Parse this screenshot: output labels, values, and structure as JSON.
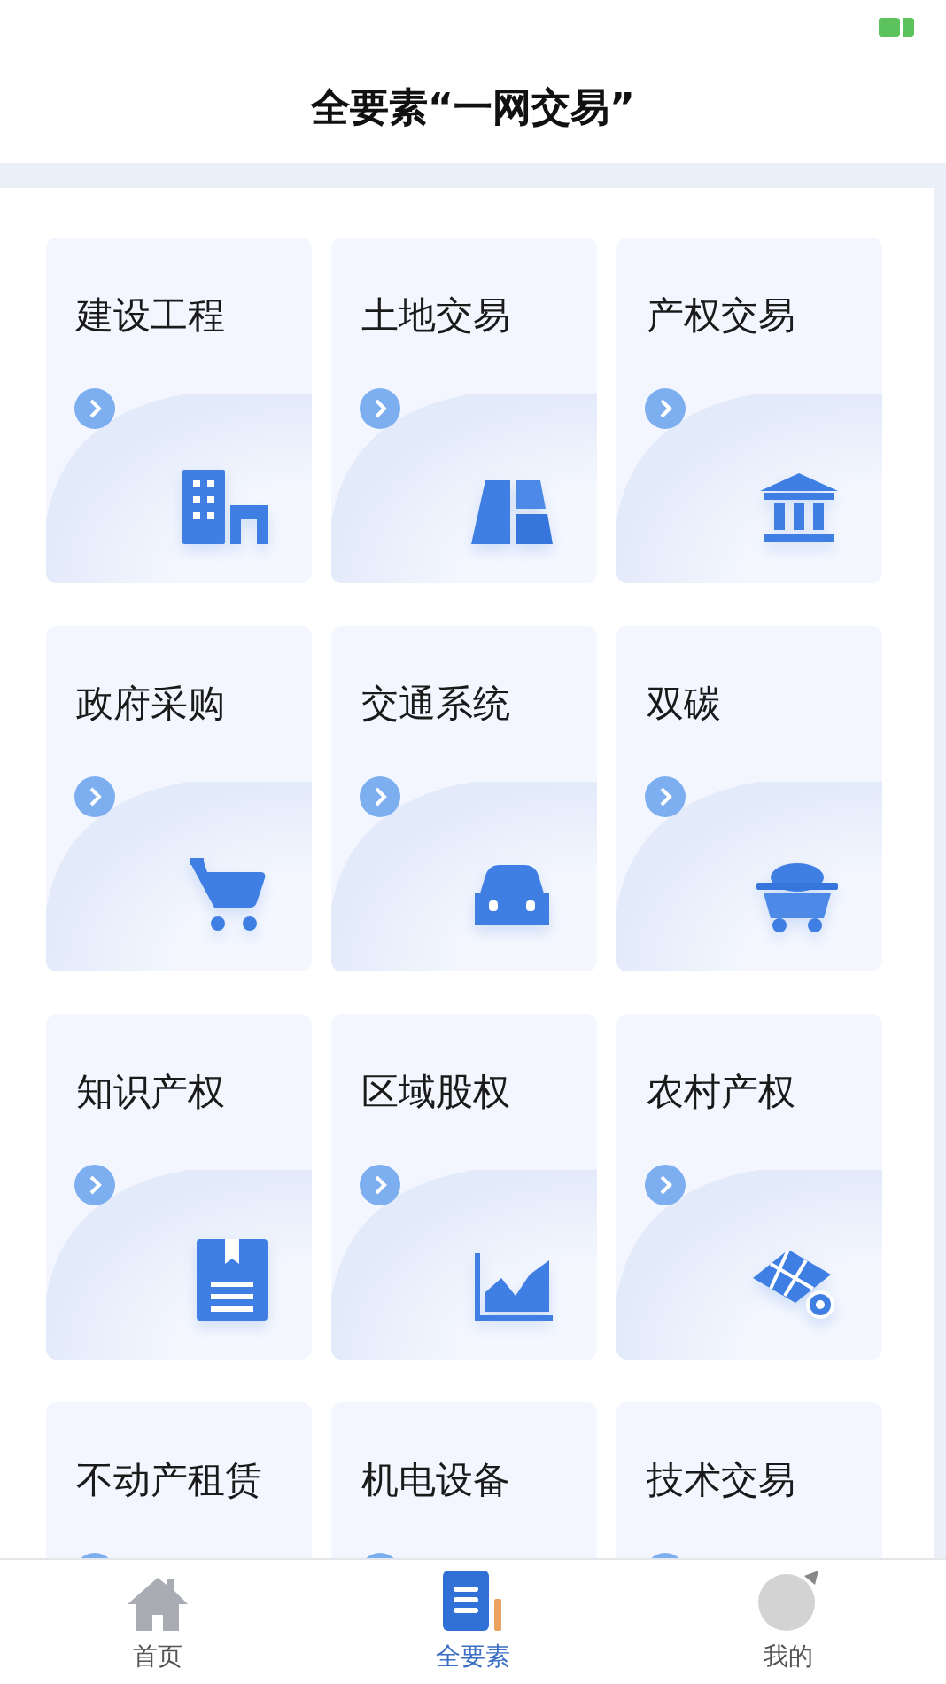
{
  "header": {
    "title": "全要素“一网交易”"
  },
  "cards": [
    {
      "title": "建设工程"
    },
    {
      "title": "土地交易"
    },
    {
      "title": "产权交易"
    },
    {
      "title": "政府采购"
    },
    {
      "title": "交通系统"
    },
    {
      "title": "双碳"
    },
    {
      "title": "知识产权"
    },
    {
      "title": "区域股权"
    },
    {
      "title": "农村产权"
    },
    {
      "title": "不动产租赁"
    },
    {
      "title": "机电设备"
    },
    {
      "title": "技术交易"
    }
  ],
  "tab_bar": [
    {
      "label": "首页",
      "selected": false
    },
    {
      "label": "全要素",
      "selected": true
    },
    {
      "label": "我的",
      "selected": false
    }
  ]
}
